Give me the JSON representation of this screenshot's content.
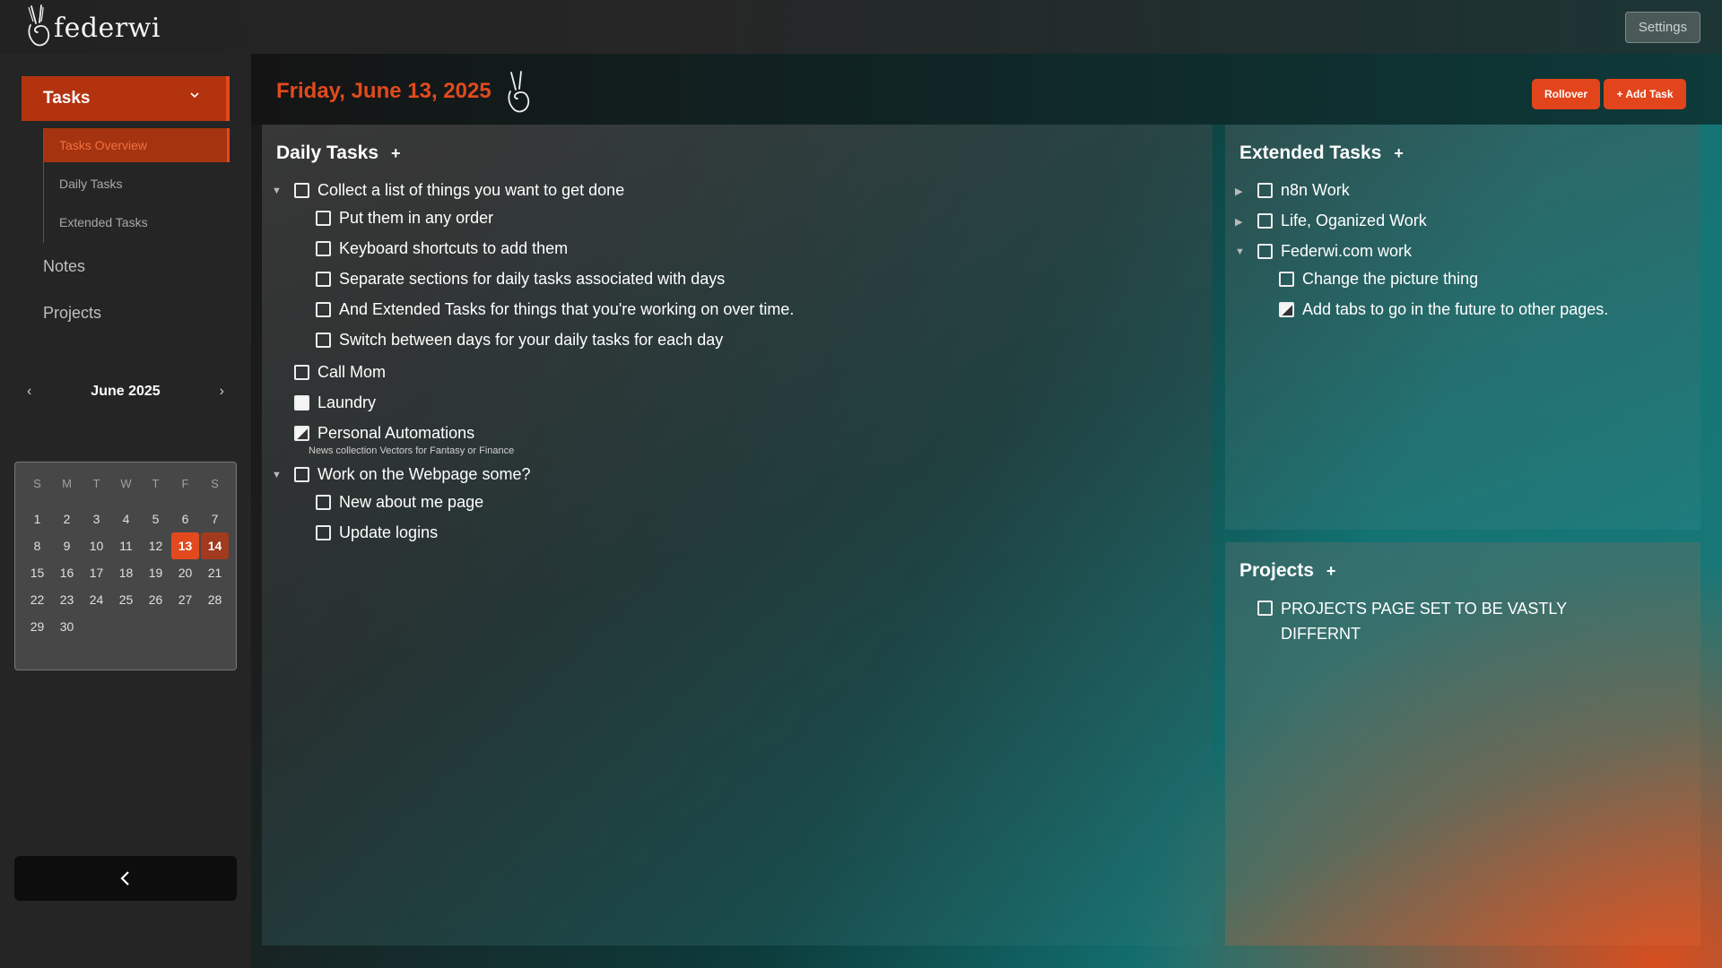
{
  "app": {
    "brand": "federwi",
    "settings_label": "Settings"
  },
  "sidebar": {
    "tasks_label": "Tasks",
    "sub_items": [
      "Tasks Overview",
      "Daily Tasks",
      "Extended Tasks"
    ],
    "notes_label": "Notes",
    "projects_label": "Projects"
  },
  "calendar": {
    "month_label": "June 2025",
    "prev": "‹",
    "next": "›",
    "days_of_week": [
      "S",
      "M",
      "T",
      "W",
      "T",
      "F",
      "S"
    ],
    "start_offset": 0,
    "days_in_month": 30,
    "today": 13,
    "selected": 14
  },
  "main": {
    "date_title": "Friday, June 13, 2025",
    "rollover_label": "Rollover",
    "add_task_label": "+ Add Task"
  },
  "daily": {
    "title": "Daily Tasks",
    "plus": "+",
    "tasks": {
      "t1": "Collect a list of things you want to get done",
      "t1a": "Put them in any order",
      "t1b": "Keyboard shortcuts to add them",
      "t1c": "Separate sections for daily tasks associated with days",
      "t1d": "And Extended Tasks for things that you're working on over time.",
      "t1e": "Switch between days for your daily tasks for each day",
      "t2": "Call Mom",
      "t3": "Laundry",
      "t4": "Personal Automations",
      "t4_note": "News collection Vectors for Fantasy or Finance",
      "t5": "Work on the Webpage some?",
      "t5a": "New about me page",
      "t5b": "Update logins"
    }
  },
  "extended": {
    "title": "Extended Tasks",
    "plus": "+",
    "tasks": {
      "e1": "n8n Work",
      "e2": "Life, Oganized Work",
      "e3": "Federwi.com work",
      "e3a": "Change the picture thing",
      "e3b": "Add tabs to go in the future to other pages."
    }
  },
  "projects": {
    "title": "Projects",
    "plus": "+",
    "items": [
      "PROJECTS PAGE SET TO BE VASTLY DIFFERNT"
    ]
  }
}
